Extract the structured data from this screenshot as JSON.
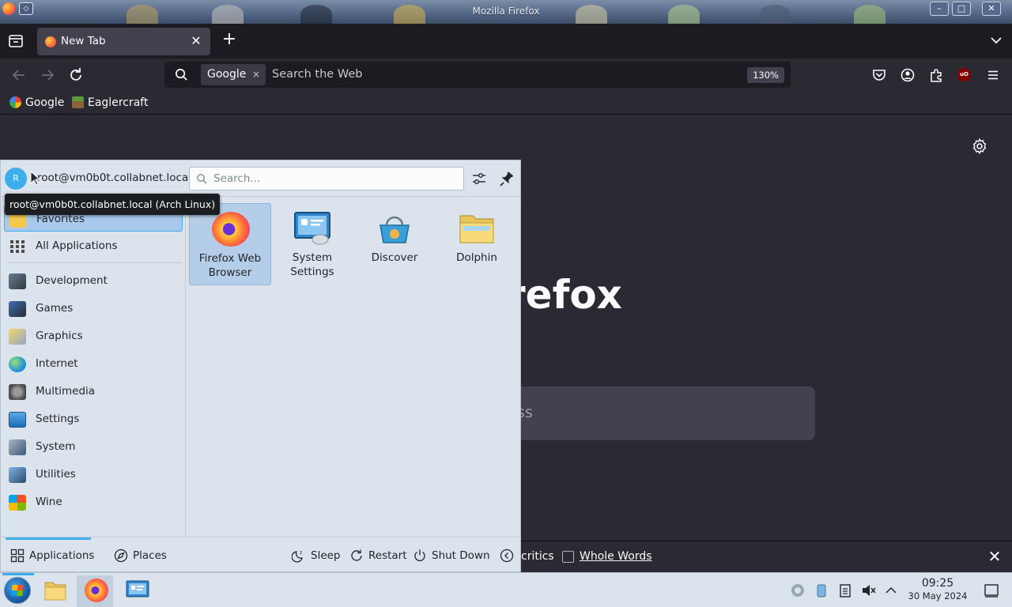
{
  "window": {
    "title": "Mozilla Firefox",
    "controls": {
      "minimize": "–",
      "maximize": "□",
      "close": "✕"
    }
  },
  "tabs": [
    {
      "label": "New Tab",
      "close": "✕"
    }
  ],
  "new_tab": "+",
  "urlbar": {
    "engine": "Google",
    "engine_clear": "×",
    "placeholder": "Search the Web",
    "zoom": "130%"
  },
  "bookmarks": [
    {
      "label": "Google",
      "icon": "google-icon"
    },
    {
      "label": "Eaglercraft",
      "icon": "grass-block-icon"
    }
  ],
  "page": {
    "brand_fragment": "refox",
    "search_fragment": "ss"
  },
  "findbar": {
    "diacritics_fragment": "critics",
    "whole_words": "Whole Words",
    "close": "✕"
  },
  "launcher": {
    "avatar_letter": "R",
    "username": "root@vm0b0t.collabnet.local (...",
    "tooltip": "root@vm0b0t.collabnet.local (Arch Linux)",
    "search_placeholder": "Search...",
    "categories": [
      {
        "label": "Favorites",
        "icon": "favorites-icon",
        "selected": true
      },
      {
        "label": "All Applications",
        "icon": "grid-icon"
      },
      {
        "label": "Development",
        "icon": "development-icon"
      },
      {
        "label": "Games",
        "icon": "games-icon"
      },
      {
        "label": "Graphics",
        "icon": "graphics-icon"
      },
      {
        "label": "Internet",
        "icon": "internet-icon"
      },
      {
        "label": "Multimedia",
        "icon": "multimedia-icon"
      },
      {
        "label": "Settings",
        "icon": "settings-icon"
      },
      {
        "label": "System",
        "icon": "system-icon"
      },
      {
        "label": "Utilities",
        "icon": "utilities-icon"
      },
      {
        "label": "Wine",
        "icon": "wine-icon"
      }
    ],
    "apps": [
      {
        "label": "Firefox Web Browser",
        "icon": "firefox-icon",
        "selected": true
      },
      {
        "label": "System Settings",
        "icon": "system-settings-icon"
      },
      {
        "label": "Discover",
        "icon": "discover-icon"
      },
      {
        "label": "Dolphin",
        "icon": "folder-icon"
      }
    ],
    "footer": {
      "applications": "Applications",
      "places": "Places",
      "sleep": "Sleep",
      "restart": "Restart",
      "shutdown": "Shut Down"
    }
  },
  "taskbar": {
    "clock_time": "09:25",
    "clock_date": "30 May 2024"
  },
  "colors": {
    "accent": "#3daee9",
    "firefox_bg": "#2b2a33",
    "launcher_bg": "#dbe3ec"
  }
}
